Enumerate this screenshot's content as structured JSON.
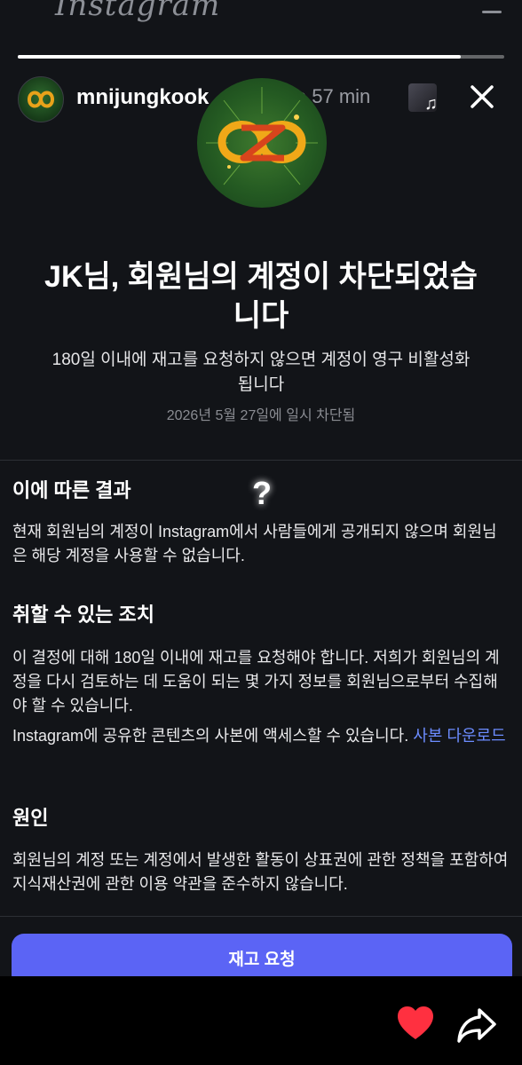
{
  "app_background": {
    "logo_text": "Instagram"
  },
  "story": {
    "username": "mnijungkook",
    "time": "· hace 57 min",
    "progress_percent": 91
  },
  "content": {
    "title": "JK님, 회원님의 계정이 차단되었습니다",
    "subtitle": "180일 이내에 재고를 요청하지 않으면 계정이 영구 비활성화됩니다",
    "date": "2026년 5월 27일에 일시 차단됨",
    "question_mark": "?",
    "sections": [
      {
        "heading": "이에 따른 결과",
        "paragraphs": [
          "현재 회원님의 계정이 Instagram에서 사람들에게 공개되지 않으며 회원님은 해당 계정을 사용할 수 없습니다."
        ]
      },
      {
        "heading": "취할 수 있는 조치",
        "paragraphs": [
          "이 결정에 대해 180일 이내에 재고를 요청해야 합니다. 저희가 회원님의 계정을 다시 검토하는 데 도움이 되는 몇 가지 정보를 회원님으로부터 수집해야 할 수 있습니다.",
          "Instagram에 공유한 콘텐츠의 사본에 액세스할 수 있습니다."
        ],
        "link": "사본 다운로드"
      },
      {
        "heading": "원인",
        "paragraphs": [
          "회원님의 계정 또는 계정에서 발생한 활동이 상표권에 관한 정책을 포함하여 지식재산권에 관한 이용 약관을 준수하지 않습니다."
        ]
      }
    ],
    "appeal_button": "재고 요청"
  },
  "colors": {
    "background": "#121418",
    "accent_button": "#5b64f5",
    "link": "#6c8cff",
    "verified": "#3897f0",
    "heart": "#ff3040"
  },
  "icons": [
    "verified-badge-icon",
    "music-note-icon",
    "close-icon",
    "heart-icon",
    "share-icon"
  ]
}
